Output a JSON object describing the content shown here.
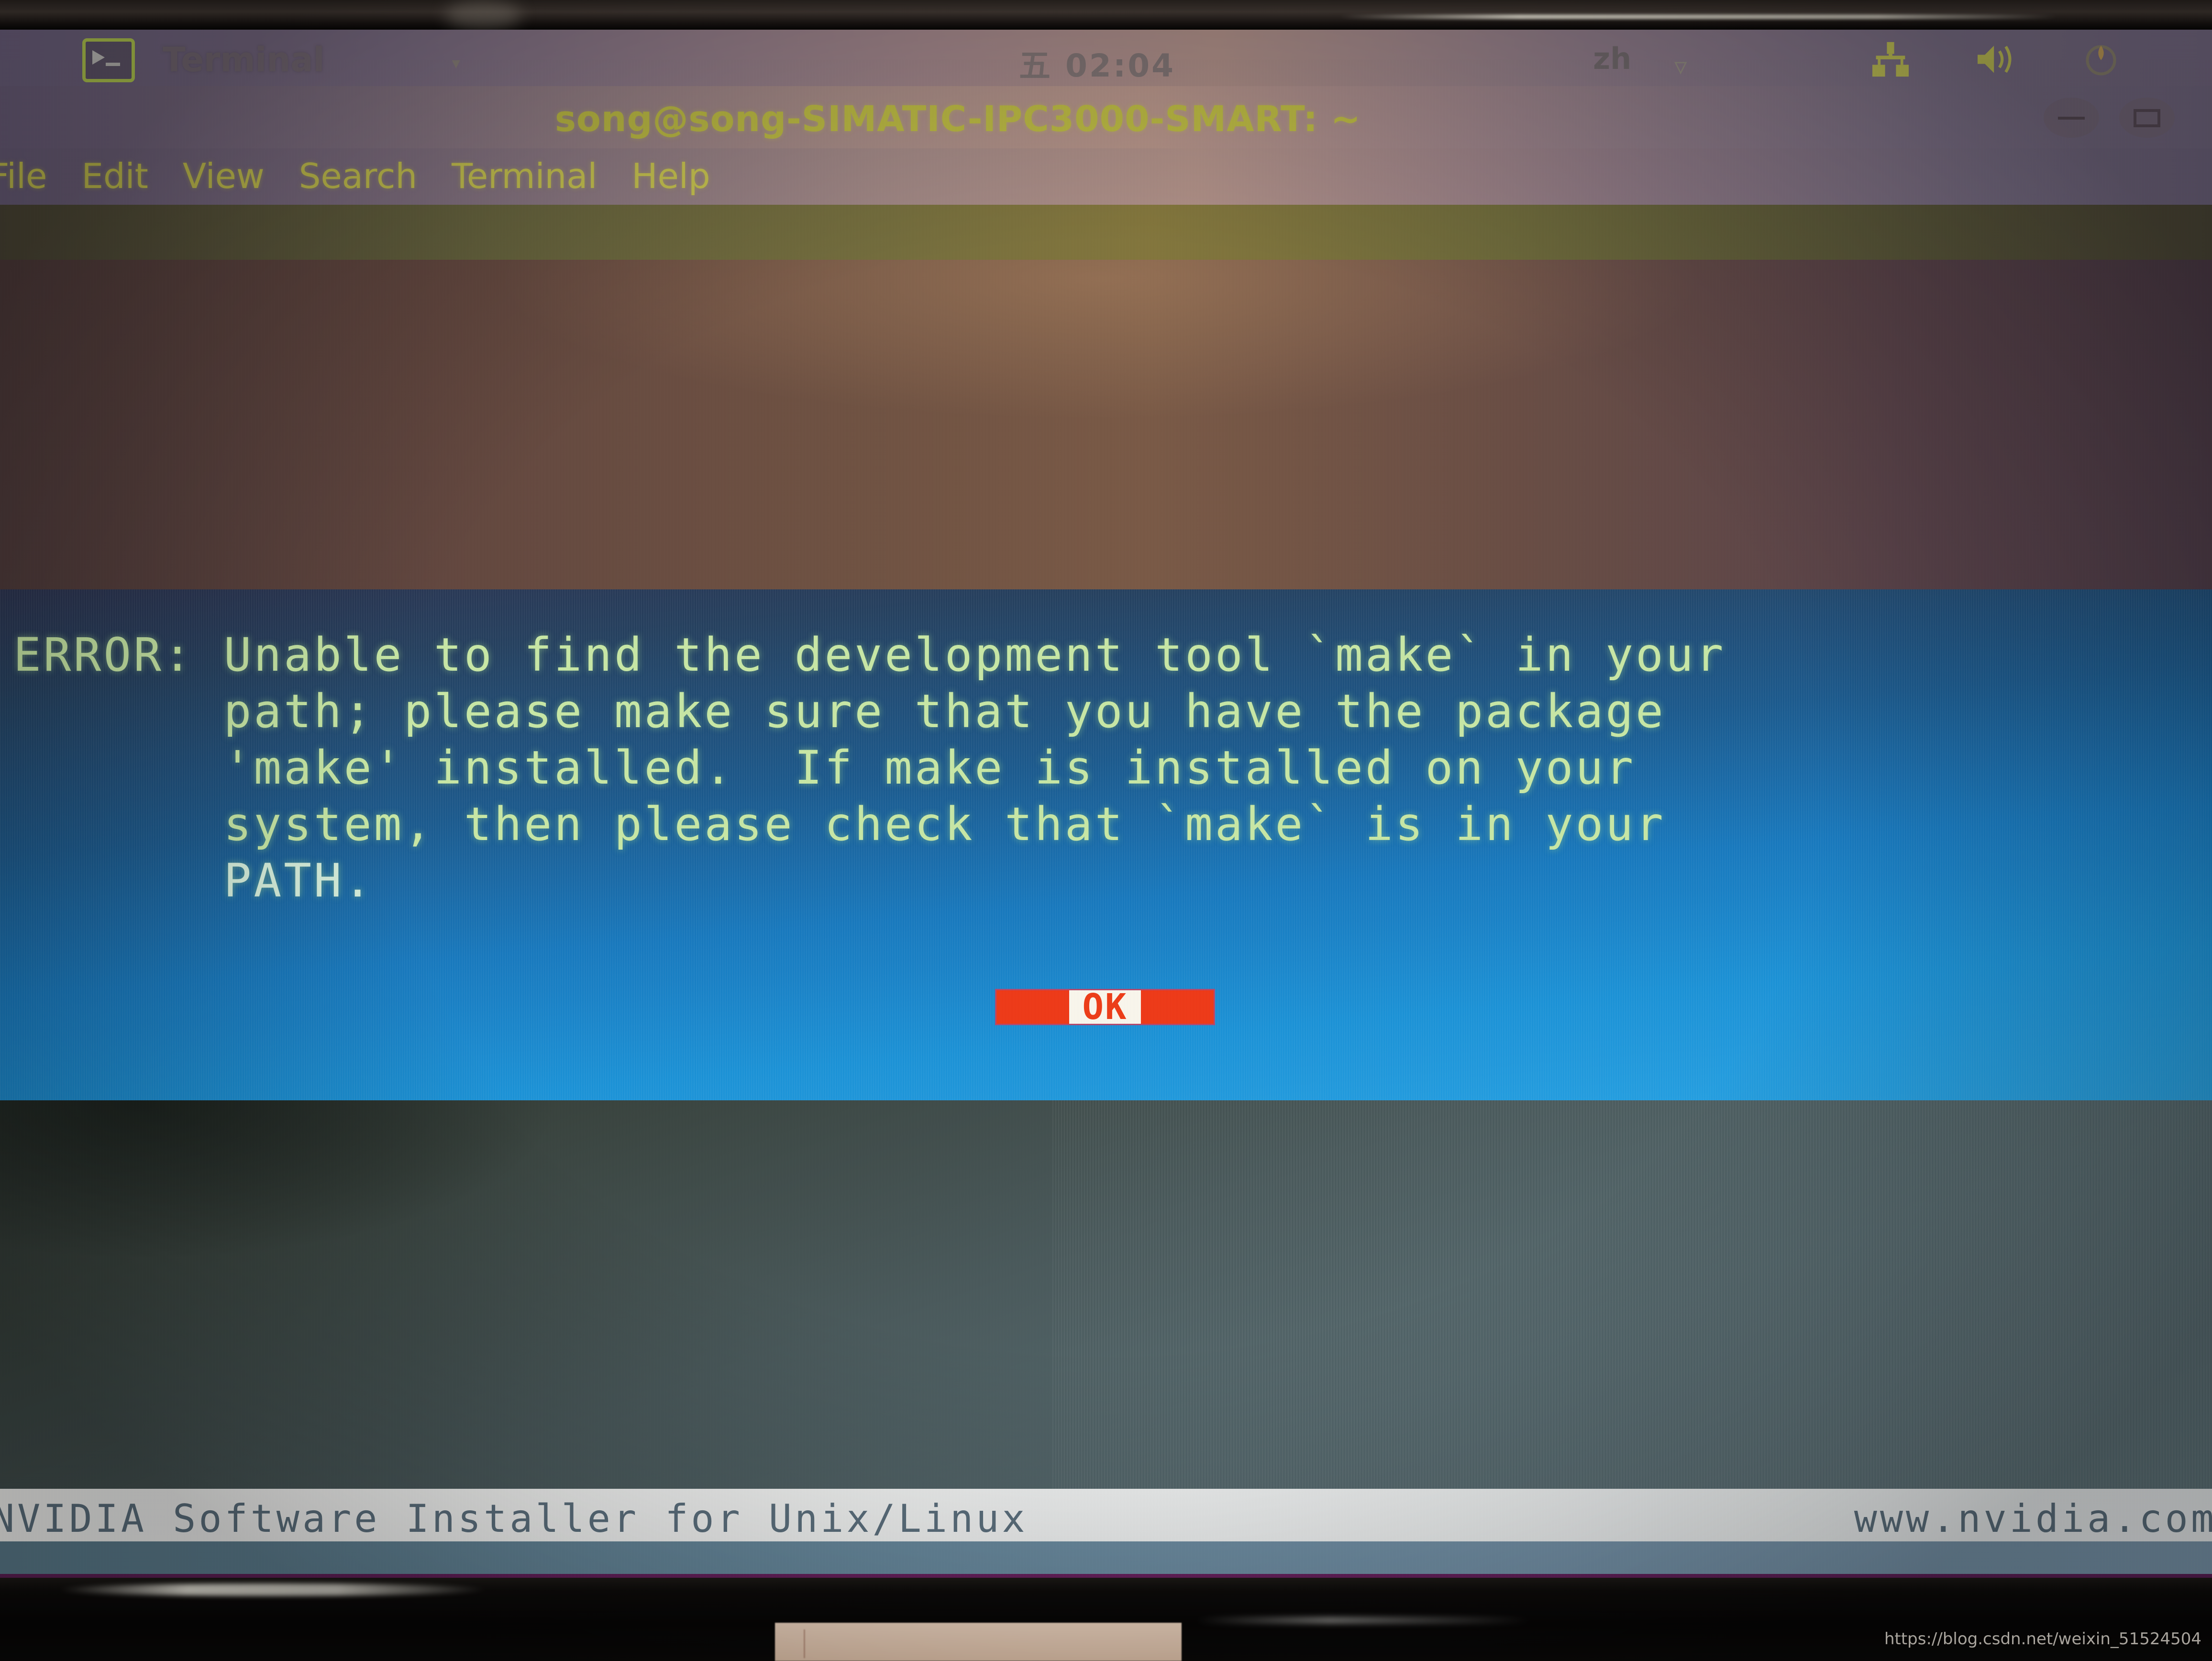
{
  "panel": {
    "app_icon": "terminal-icon",
    "app_name": "Terminal",
    "app_chevron": "▾",
    "clock": "五 02:04",
    "input_method": "zh",
    "input_chevron": "▽",
    "network_icon": "network-icon",
    "volume_icon": "volume-icon",
    "power_icon": "power-icon"
  },
  "window": {
    "title": "song@song-SIMATIC-IPC3000-SMART: ~",
    "minimize_label": "–",
    "maximize_label": "□"
  },
  "menubar": {
    "items": [
      "File",
      "Edit",
      "View",
      "Search",
      "Terminal",
      "Help"
    ]
  },
  "dialog": {
    "type": "error",
    "lines": [
      "ERROR: Unable to find the development tool `make` in your",
      "       path; please make sure that you have the package",
      "       'make' installed.  If make is installed on your",
      "       system, then please check that `make` is in your",
      "       PATH.",
      ""
    ],
    "full_text": "ERROR: Unable to find the development tool `make` in your path; please make sure that you have the package 'make' installed.  If make is installed on your system, then please check that `make` is in your PATH.",
    "button_label": "OK",
    "colors": {
      "bg_top": "#2b3350",
      "bg_bottom": "#27a4e6",
      "text": "#c9e9a6",
      "button_bg": "#f03a18",
      "button_core": "#fbf8ee",
      "button_text": "#ef3d18"
    }
  },
  "statusbar": {
    "left": "NVIDIA Software Installer for Unix/Linux",
    "right": "www.nvidia.com"
  },
  "watermark": {
    "text": "https://blog.csdn.net/weixin_51524504"
  }
}
